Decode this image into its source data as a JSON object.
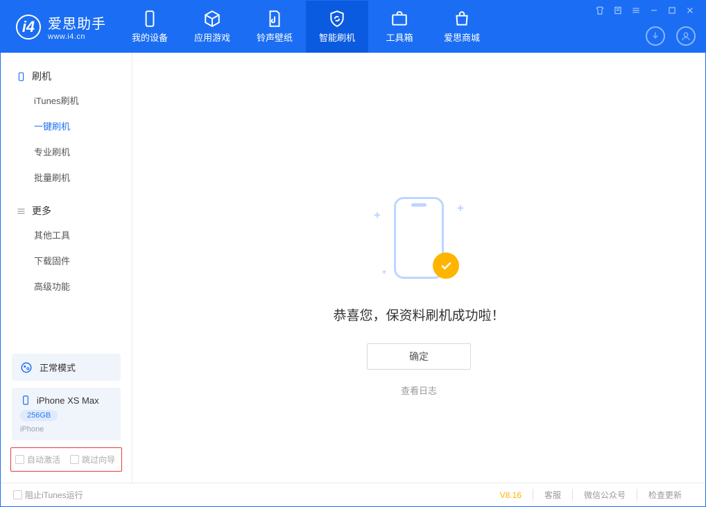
{
  "app": {
    "name": "爱思助手",
    "domain": "www.i4.cn"
  },
  "tabs": {
    "device": "我的设备",
    "apps": "应用游戏",
    "ring": "铃声壁纸",
    "flash": "智能刷机",
    "toolbox": "工具箱",
    "store": "爱思商城"
  },
  "sidebar": {
    "flash_head": "刷机",
    "items": {
      "itunes": "iTunes刷机",
      "onekey": "一键刷机",
      "pro": "专业刷机",
      "batch": "批量刷机"
    },
    "more_head": "更多",
    "more": {
      "other": "其他工具",
      "fw": "下载固件",
      "adv": "高级功能"
    },
    "mode": "正常模式",
    "device_name": "iPhone XS Max",
    "device_cap": "256GB",
    "device_type": "iPhone",
    "cb_auto": "自动激活",
    "cb_skip": "跳过向导"
  },
  "main": {
    "message": "恭喜您，保资料刷机成功啦！",
    "ok": "确定",
    "log": "查看日志"
  },
  "footer": {
    "block_itunes": "阻止iTunes运行",
    "version": "V8.16",
    "support": "客服",
    "wechat": "微信公众号",
    "update": "检查更新"
  }
}
